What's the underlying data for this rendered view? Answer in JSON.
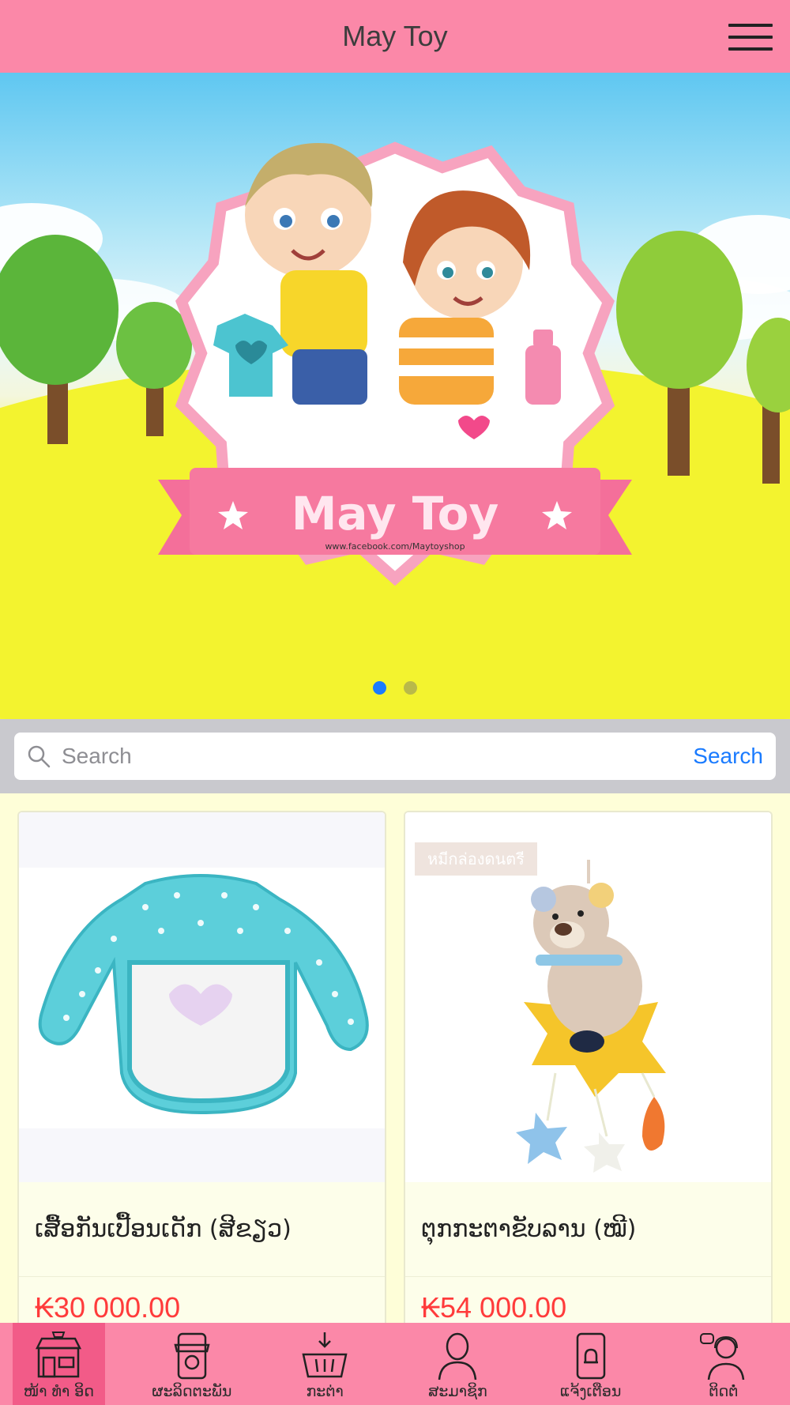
{
  "header": {
    "title": "May Toy",
    "menu_icon": "hamburger-menu-icon"
  },
  "banner": {
    "logo_text": "May Toy",
    "logo_url_text": "www.facebook.com/Maytoyshop",
    "slides_count": 2,
    "active_slide": 1
  },
  "search": {
    "placeholder": "Search",
    "button_label": "Search"
  },
  "products": [
    {
      "name": "ເສື້ອກັນເປື້ອນເດັກ (ສີຂຽວ)",
      "price": "₭30 000.00",
      "tag": ""
    },
    {
      "name": "ຕຸກກະຕາຂັບລານ (ໝີ)",
      "price": "₭54 000.00",
      "tag": "หมีกล่องดนตรี"
    }
  ],
  "bottom_nav": {
    "items": [
      {
        "label": "ໜ້າ ທຳ ອິດ",
        "icon": "storefront-icon",
        "active": true
      },
      {
        "label": "ຜະລິດຕະພັນ",
        "icon": "phone-shop-icon",
        "active": false
      },
      {
        "label": "ກະຕ່າ",
        "icon": "basket-icon",
        "active": false
      },
      {
        "label": "ສະມາຊິກ",
        "icon": "member-icon",
        "active": false
      },
      {
        "label": "ແຈ້ງເຕືອນ",
        "icon": "notification-phone-icon",
        "active": false
      },
      {
        "label": "ຕິດຕໍ່",
        "icon": "support-agent-icon",
        "active": false
      }
    ]
  },
  "colors": {
    "header": "#fb88a8",
    "accent": "#1a7bff",
    "price": "#ff3b3b",
    "product_bg": "#fefed8"
  }
}
